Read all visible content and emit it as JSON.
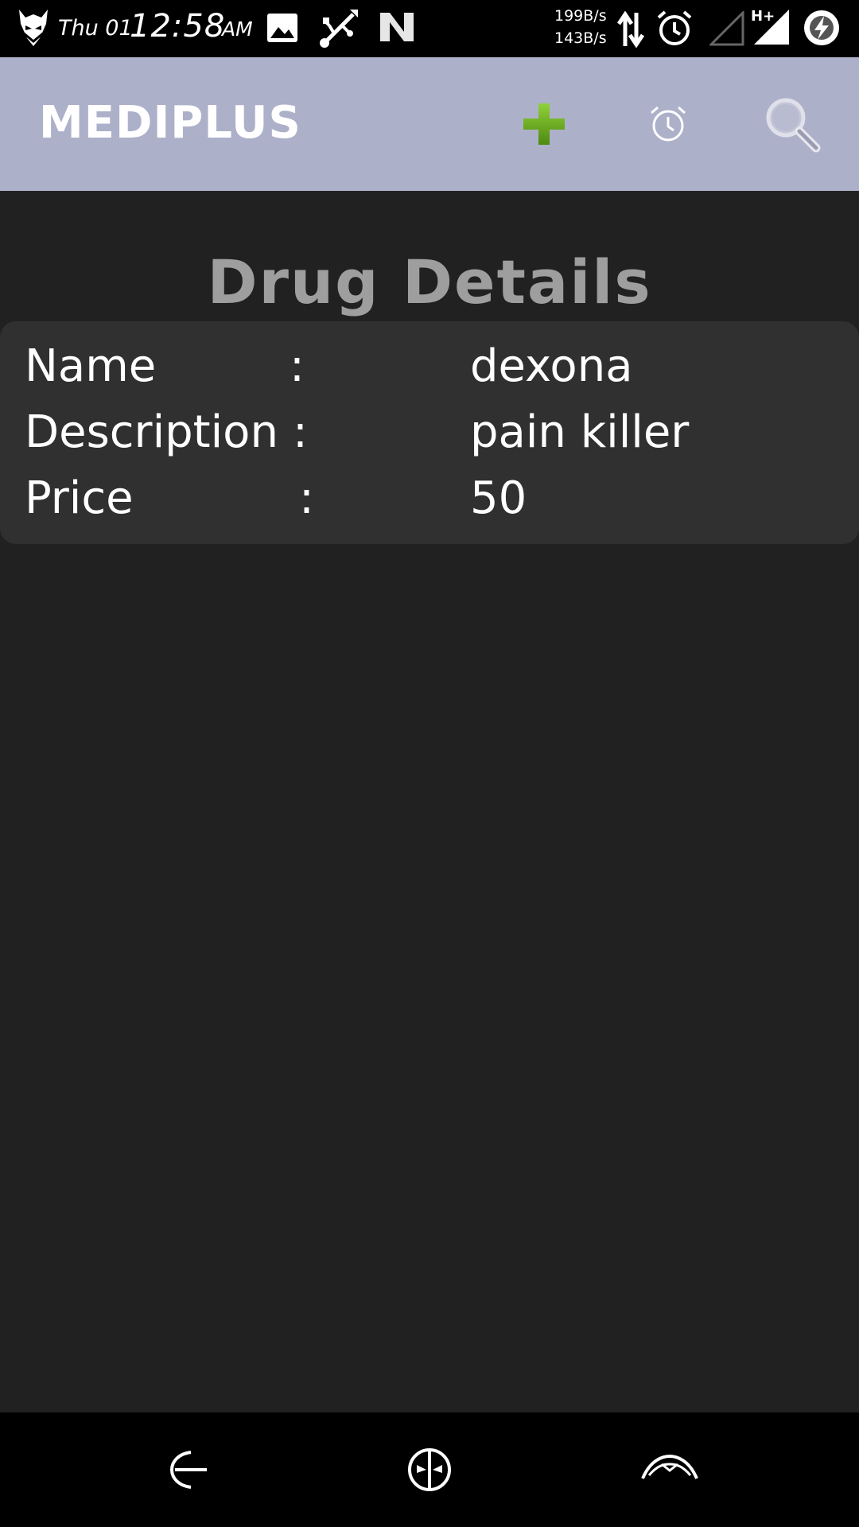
{
  "status_bar": {
    "day": "Thu 01",
    "time": "12:58",
    "ampm": "AM",
    "speed_up": "199B/s",
    "speed_down": "143B/s",
    "icons": [
      "mascot-icon",
      "image-icon",
      "usb-icon",
      "n-icon",
      "data-arrows-icon",
      "alarm-icon",
      "signal-empty-icon",
      "hplus-signal-icon",
      "battery-charging-icon"
    ],
    "network_type": "H+"
  },
  "app_bar": {
    "title": "MEDIPLUS",
    "actions": [
      "add-icon",
      "alarm-icon",
      "search-icon"
    ],
    "add_color": "#6aab1e"
  },
  "page": {
    "heading": "Drug Details"
  },
  "details": {
    "rows": [
      {
        "label": "Name",
        "colon": ":",
        "value": "dexona"
      },
      {
        "label": "Description",
        "colon": ":",
        "value": "pain killer"
      },
      {
        "label": "Price",
        "colon": ":",
        "value": "50"
      }
    ]
  },
  "nav_bar": {
    "buttons": [
      "back-icon",
      "home-icon",
      "recents-icon"
    ]
  },
  "colors": {
    "app_bar_bg": "#adb0c9",
    "background": "#212121",
    "card_bg": "#303030",
    "heading": "#9e9e9e"
  }
}
